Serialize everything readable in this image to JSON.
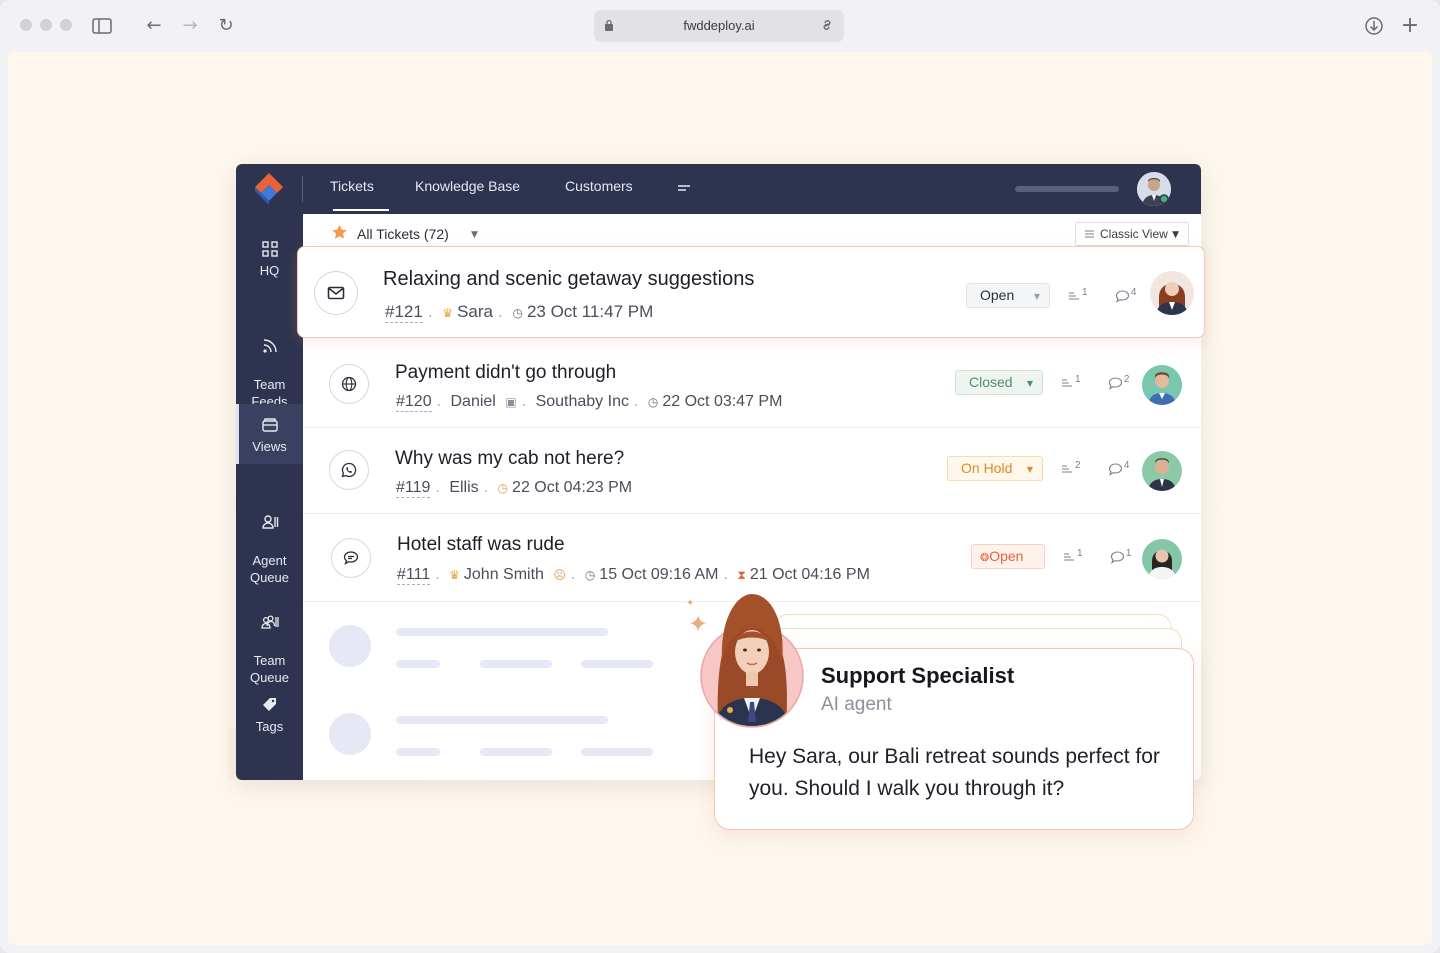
{
  "browser": {
    "url": "fwddeploy.ai"
  },
  "app": {
    "tabs": [
      {
        "label": "Tickets"
      },
      {
        "label": "Knowledge Base"
      },
      {
        "label": "Customers"
      }
    ],
    "sidebar": [
      {
        "label": "HQ",
        "icon": "grid-icon"
      },
      {
        "label": "Team\nFeeds",
        "icon": "feeds-icon"
      },
      {
        "label": "Views",
        "icon": "views-icon"
      },
      {
        "label": "Agent\nQueue",
        "icon": "agent-queue-icon"
      },
      {
        "label": "Team\nQueue",
        "icon": "team-queue-icon"
      },
      {
        "label": "Tags",
        "icon": "tag-icon"
      }
    ],
    "list": {
      "filter_label": "All Tickets (72)",
      "view_toggle": "Classic View"
    },
    "tickets": [
      {
        "title": "Relaxing and scenic getaway suggestions",
        "id": "#121",
        "requester": "Sara",
        "time": "23 Oct 11:47 PM",
        "status": "Open",
        "status_color": "#4a4d59",
        "tasks": "1",
        "comments": "4",
        "channel": "email-icon"
      },
      {
        "title": "Payment didn't go through",
        "id": "#120",
        "requester": "Daniel",
        "org": "Southaby Inc",
        "time": "22 Oct 03:47 PM",
        "status": "Closed",
        "status_color": "#4a8f6f",
        "tasks": "1",
        "comments": "2",
        "channel": "globe-icon"
      },
      {
        "title": "Why was my cab not here?",
        "id": "#119",
        "requester": "Ellis",
        "time": "22 Oct 04:23 PM",
        "status": "On Hold",
        "status_color": "#d98a2b",
        "tasks": "2",
        "comments": "4",
        "channel": "whatsapp-icon"
      },
      {
        "title": "Hotel staff was rude",
        "id": "#111",
        "requester": "John Smith",
        "time": "15 Oct 09:16 AM",
        "due": "21 Oct 04:16 PM",
        "status": "Open",
        "status_color": "#e0643e",
        "tasks": "1",
        "comments": "1",
        "channel": "chat-icon"
      }
    ]
  },
  "ai_agent": {
    "name": "Support Specialist",
    "role": "AI agent",
    "message": "Hey Sara, our Bali retreat sounds perfect for you. Should I walk you through it?"
  }
}
